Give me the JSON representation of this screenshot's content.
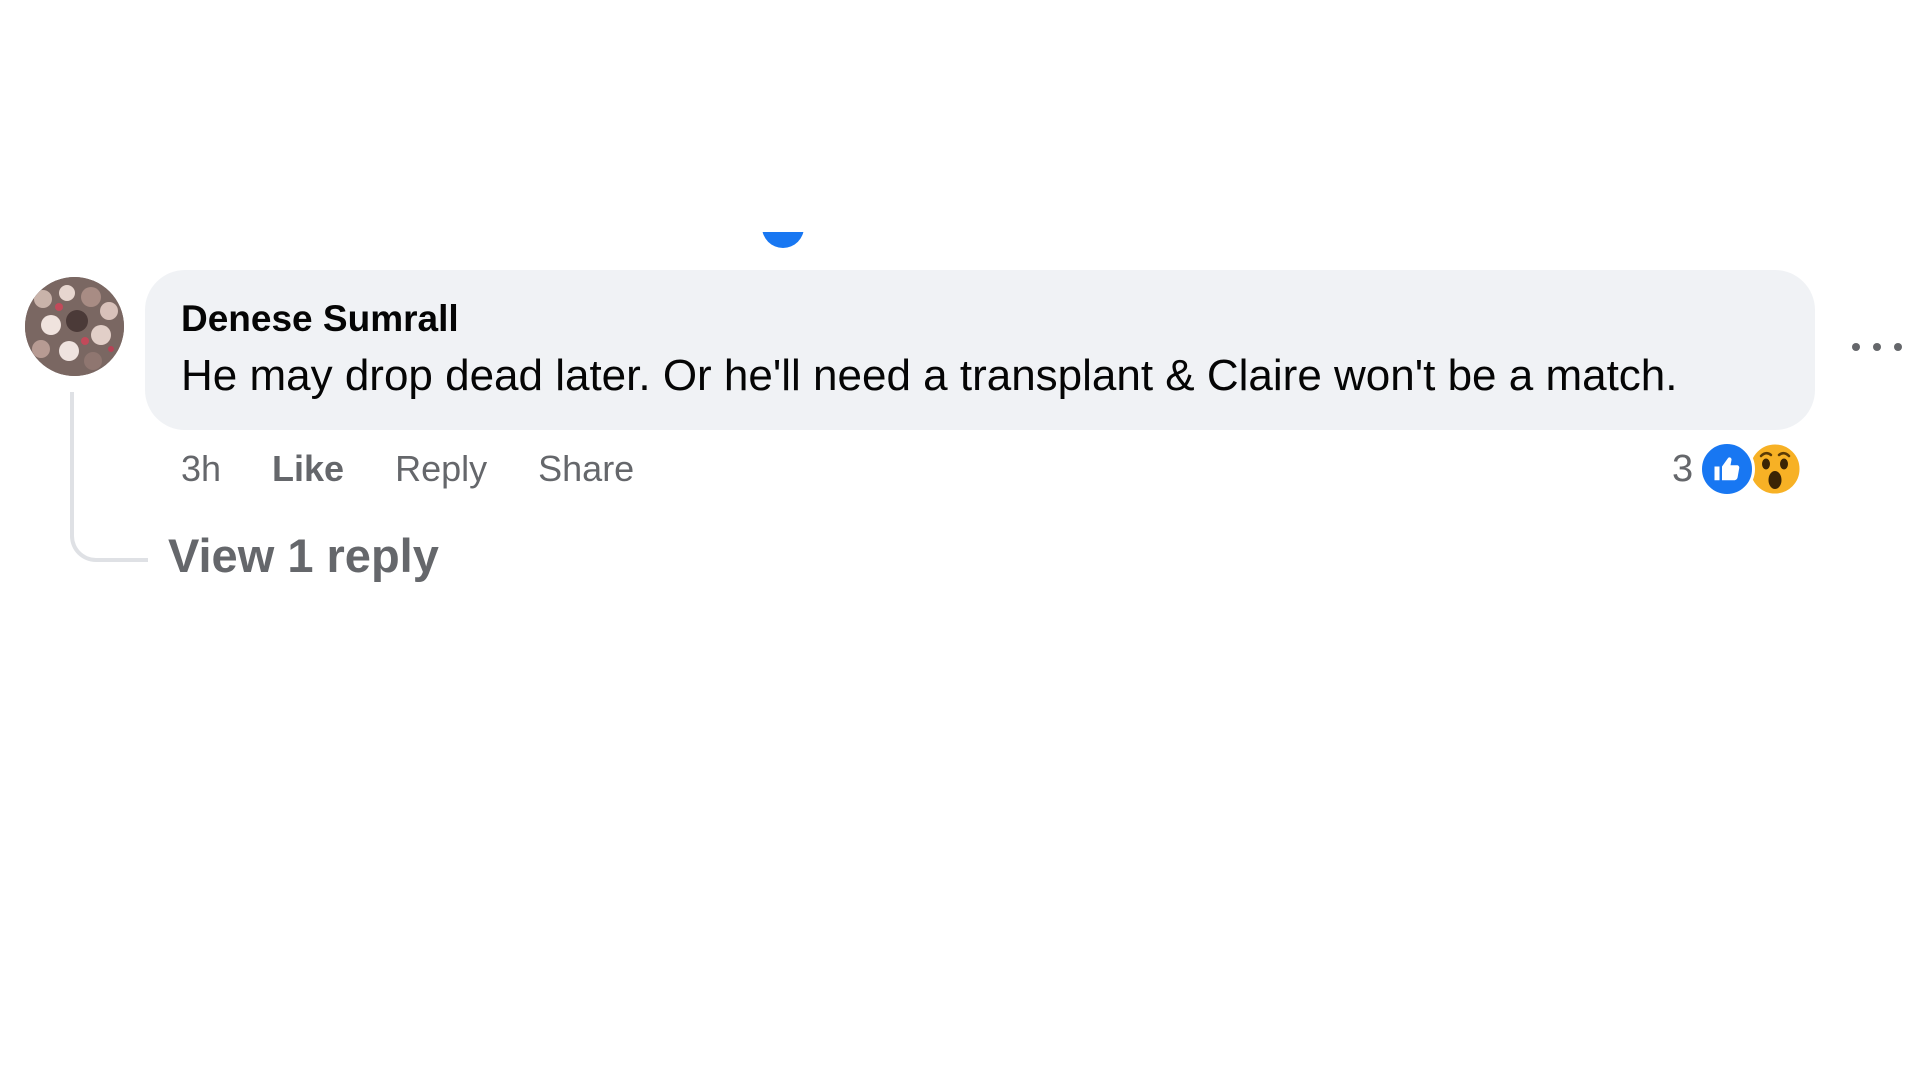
{
  "comment": {
    "author": "Denese Sumrall",
    "text": "He may drop dead later. Or he'll need a transplant & Claire won't be a match.",
    "time": "3h",
    "actions": {
      "like": "Like",
      "reply": "Reply",
      "share": "Share"
    },
    "reactions": {
      "count": "3",
      "icons": [
        "like-icon",
        "wow-icon"
      ]
    },
    "more_icon": "more-horizontal-icon",
    "view_replies": "View 1 reply"
  },
  "colors": {
    "bubble": "#f0f2f5",
    "secondary_text": "#65676b",
    "primary_text": "#050505",
    "accent": "#1877f2",
    "thread_line": "#dfe1e5"
  }
}
